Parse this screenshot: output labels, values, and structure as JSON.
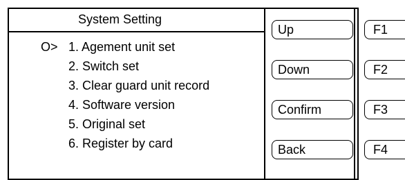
{
  "screen": {
    "title": "System Setting",
    "cursor_symbol": "O>",
    "menu_items": [
      "1. Agement unit set",
      "2. Switch set",
      "3. Clear guard unit record",
      "4. Software version",
      "5. Original set",
      "6. Register by card"
    ],
    "selected_index": 0
  },
  "soft_buttons": {
    "up": "Up",
    "down": "Down",
    "confirm": "Confirm",
    "back": "Back"
  },
  "function_keys": {
    "f1": "F1",
    "f2": "F2",
    "f3": "F3",
    "f4": "F4"
  }
}
